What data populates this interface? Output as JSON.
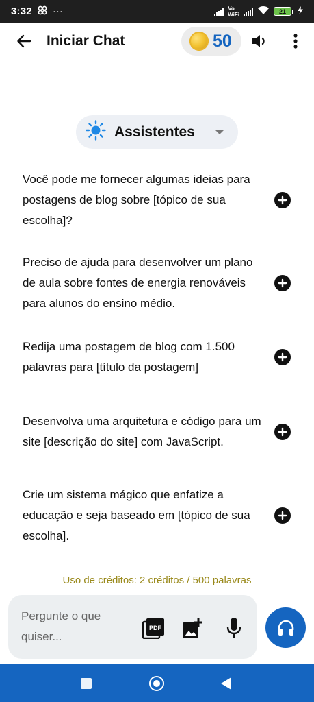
{
  "status_bar": {
    "time": "3:32",
    "overflow": "···",
    "network_label_top": "Vo",
    "network_label_bottom": "WiFi",
    "battery": "21"
  },
  "app_bar": {
    "title": "Iniciar Chat",
    "credits": "50",
    "icons": [
      "arrow-left-icon",
      "coin-icon",
      "speaker-icon",
      "more-vert-icon"
    ]
  },
  "assistants": {
    "label": "Assistentes",
    "icon": "sun-icon"
  },
  "suggestions": [
    {
      "text": "Você pode me fornecer algumas ideias para postagens de blog sobre [tópico de sua escolha]?"
    },
    {
      "text": "Preciso de ajuda para desenvolver um plano de aula sobre fontes de energia renováveis para alunos do ensino médio."
    },
    {
      "text": "Redija uma postagem de blog com 1.500 palavras para [título da postagem]"
    },
    {
      "text": "Desenvolva uma arquitetura e código para um site [descrição do site] com JavaScript."
    },
    {
      "text": "Crie um sistema mágico que enfatize a educação e seja baseado em [tópico de sua escolha]."
    }
  ],
  "usage_note": "Uso de créditos: 2 créditos / 500 palavras",
  "composer": {
    "placeholder": "Pergunte o que quiser...",
    "icons": [
      "pdf-icon",
      "add-image-icon",
      "microphone-icon",
      "headphones-icon"
    ]
  },
  "colors": {
    "accent": "#1565c0",
    "usage_text": "#9a8a1c",
    "pill_bg": "#edf0f5"
  }
}
